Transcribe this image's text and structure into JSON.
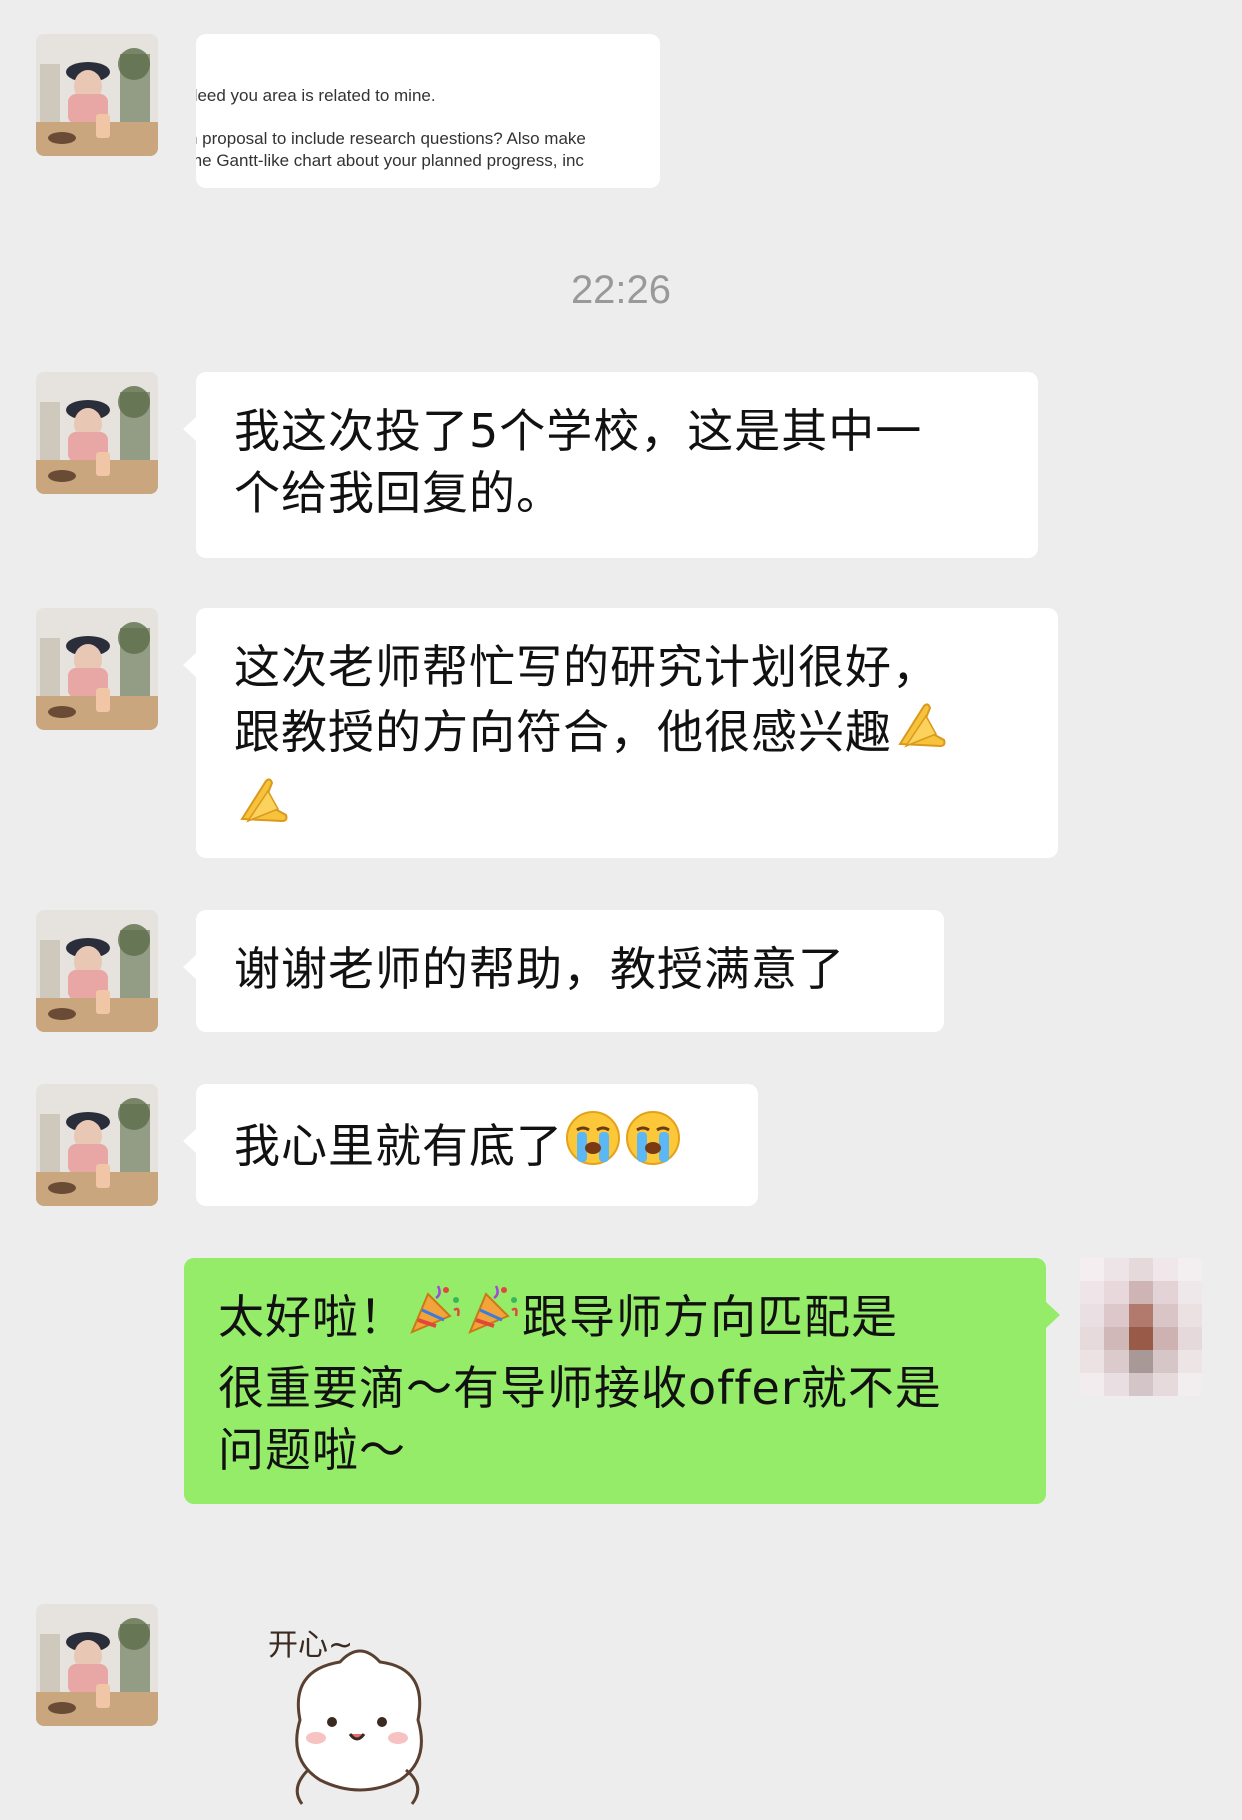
{
  "chat": {
    "image_message": {
      "line1": "deed you area is related to mine.",
      "line2": "h proposal to include research questions? Also make",
      "line3": "me Gantt-like chart about your planned progress, inc"
    },
    "timestamp": "22:26",
    "messages": [
      {
        "sender": "contact",
        "text_parts": [
          "我这次投了5个学校，这是其中一",
          "个给我回复的。"
        ]
      },
      {
        "sender": "contact",
        "text_parts": [
          "这次老师帮忙写的研究计划很好，",
          "跟教授的方向符合，他很感兴趣"
        ],
        "emoji": "folded-hands"
      },
      {
        "sender": "contact",
        "text": "谢谢老师的帮助，教授满意了"
      },
      {
        "sender": "contact",
        "text": "我心里就有底了",
        "emoji": "loudly-crying-face"
      },
      {
        "sender": "me",
        "line1_a": "太好啦！",
        "line1_b": "跟导师方向匹配是",
        "line2": "很重要滴～有导师接收offer就不是",
        "line3": "问题啦～",
        "emoji": "party-popper"
      }
    ],
    "sticker": {
      "caption": "开心~",
      "icon": "cute-bun-sticker"
    }
  },
  "colors": {
    "background": "#ededed",
    "bubble_contact": "#ffffff",
    "bubble_me": "#95ec69",
    "timestamp": "#999999"
  }
}
